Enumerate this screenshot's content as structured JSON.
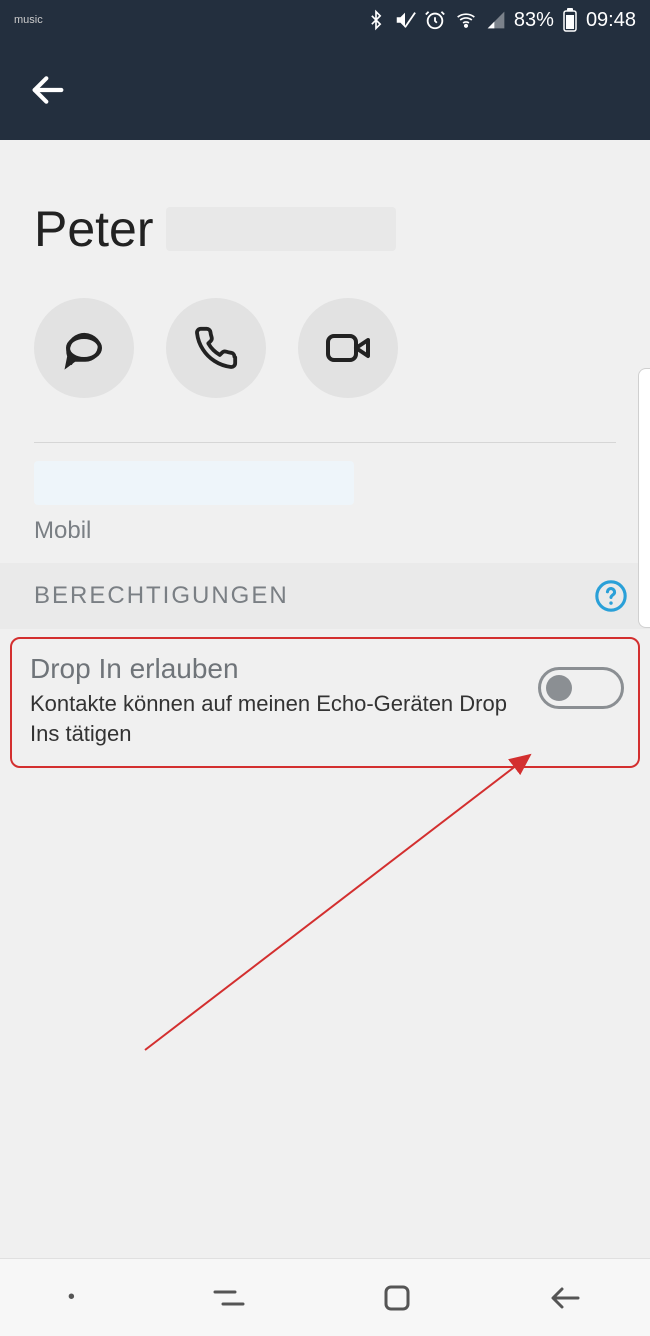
{
  "status": {
    "music_label": "music",
    "battery_pct": "83%",
    "time": "09:48",
    "icons": [
      "bluetooth",
      "mute",
      "alarm",
      "wifi",
      "signal",
      "battery"
    ]
  },
  "contact": {
    "name_visible": "Peter",
    "phone_type": "Mobil"
  },
  "actions": {
    "chat": "chat",
    "call": "call",
    "video": "video"
  },
  "sections": {
    "permissions_header": "BERECHTIGUNGEN"
  },
  "permission": {
    "title": "Drop In erlauben",
    "description": "Kontakte können auf meinen Echo-Geräten Drop Ins tätigen",
    "enabled": false
  },
  "annotation": {
    "highlight": "red-box",
    "arrow": true
  },
  "colors": {
    "header_bg": "#232f3e",
    "annotation": "#d32f2f",
    "help_icon": "#2aa0d8"
  }
}
